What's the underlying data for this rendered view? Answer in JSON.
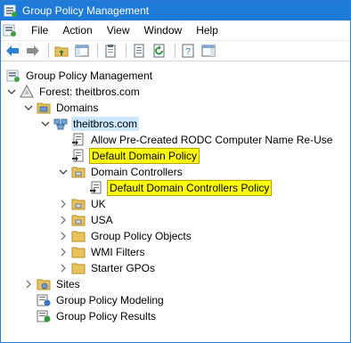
{
  "window": {
    "title": "Group Policy Management"
  },
  "menu": {
    "file": "File",
    "action": "Action",
    "view": "View",
    "window": "Window",
    "help": "Help"
  },
  "colors": {
    "titlebar": "#1e7bd8",
    "highlight": "#ffff00",
    "selected": "#cce8ff"
  },
  "tree": {
    "root": "Group Policy Management",
    "forest": "Forest: theitbros.com",
    "domains": "Domains",
    "domain": "theitbros.com",
    "gpo_rodc": "Allow Pre-Created RODC Computer Name Re-Use",
    "gpo_default_domain": "Default Domain Policy",
    "domain_controllers": "Domain Controllers",
    "gpo_default_dc": "Default Domain Controllers Policy",
    "ou_uk": "UK",
    "ou_usa": "USA",
    "gpo_objects": "Group Policy Objects",
    "wmi_filters": "WMI Filters",
    "starter_gpos": "Starter GPOs",
    "sites": "Sites",
    "modeling": "Group Policy Modeling",
    "results": "Group Policy Results"
  }
}
